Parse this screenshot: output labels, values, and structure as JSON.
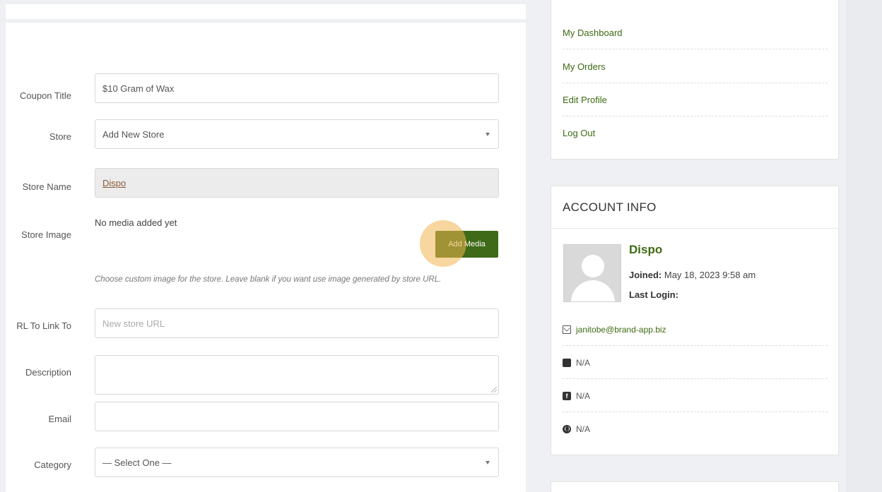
{
  "form": {
    "coupon_title": {
      "label": "Coupon Title",
      "value": "$10 Gram of Wax"
    },
    "store": {
      "label": "Store",
      "value": "Add New Store"
    },
    "store_name": {
      "label": "Store Name",
      "value": "Dispo"
    },
    "store_image": {
      "label": "Store Image",
      "empty_text": "No media added yet",
      "button_label": "Add Media",
      "help_text": "Choose custom image for the store. Leave blank if you want use image generated by store URL."
    },
    "url": {
      "label": "RL To Link To",
      "placeholder": "New store URL"
    },
    "description": {
      "label": "Description",
      "value": ""
    },
    "email": {
      "label": "Email",
      "value": ""
    },
    "category": {
      "label": "Category",
      "value": "— Select One —"
    }
  },
  "sidebar": {
    "nav": [
      {
        "label": "My Dashboard"
      },
      {
        "label": "My Orders"
      },
      {
        "label": "Edit Profile"
      },
      {
        "label": "Log Out"
      }
    ],
    "account": {
      "title": "ACCOUNT INFO",
      "name": "Dispo",
      "joined_label": "Joined:",
      "joined_value": "May 18, 2023 9:58 am",
      "last_login_label": "Last Login:",
      "email": "janitobe@brand-app.biz",
      "twitter": "N/A",
      "facebook": "N/A",
      "website": "N/A"
    }
  },
  "colors": {
    "accent_green": "#3d6b12",
    "button_green": "#3f6a17",
    "click_highlight": "#f0b450"
  },
  "icons": [
    "mail-icon",
    "twitter-icon",
    "facebook-icon",
    "globe-icon",
    "chevron-down-icon",
    "avatar-placeholder-icon"
  ]
}
